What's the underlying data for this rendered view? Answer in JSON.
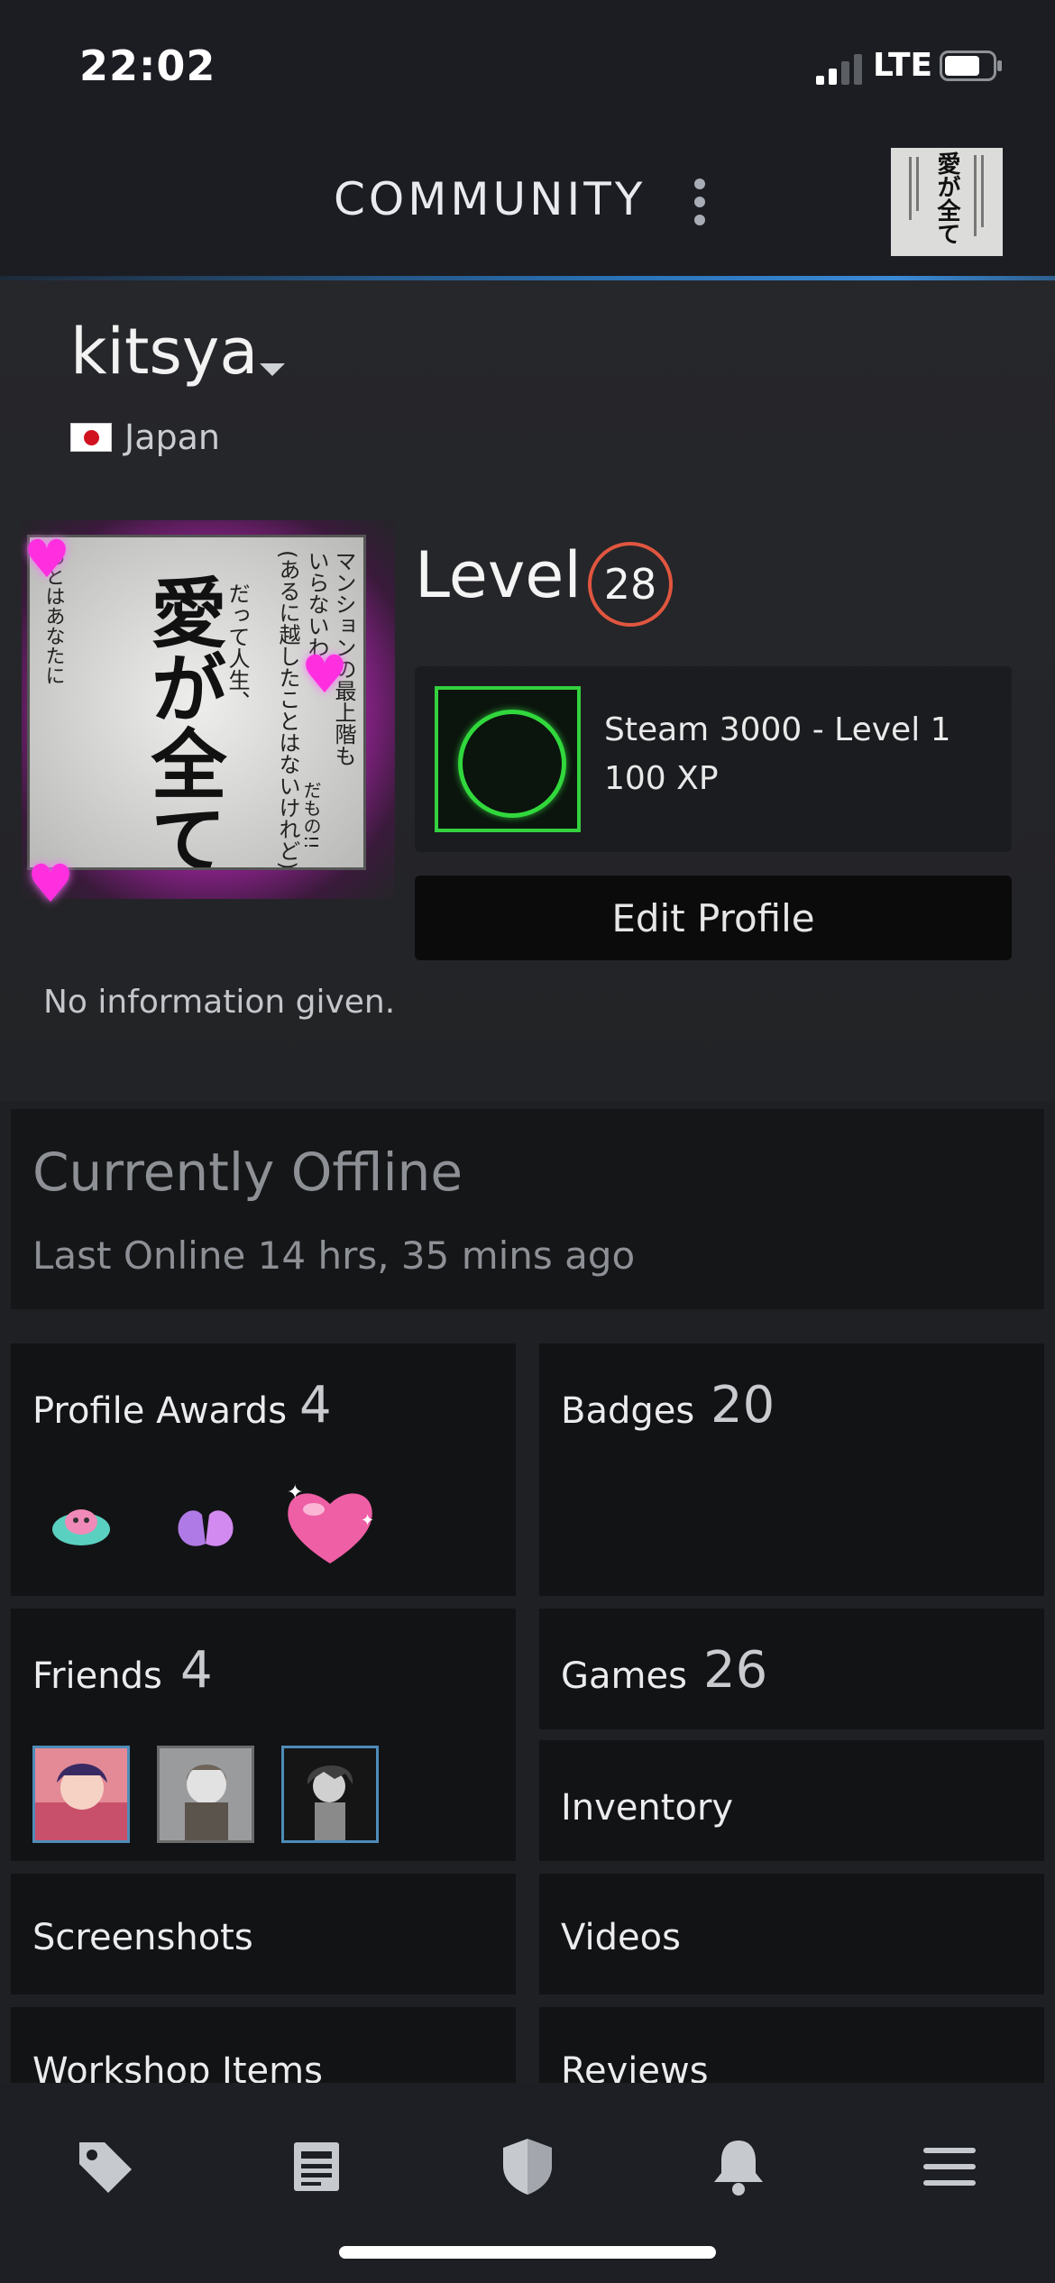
{
  "status_bar": {
    "time": "22:02",
    "network": "LTE"
  },
  "header": {
    "title": "COMMUNITY",
    "menu_icon": "kebab-menu-icon",
    "avatar_text": "愛が全て"
  },
  "profile": {
    "username": "kitsya",
    "country": "Japan",
    "avatar": {
      "headline": "愛が全て",
      "line1": "マンションの最上階も",
      "line2": "いらないわ!!",
      "line3": "(あるに越したことはないけれど)",
      "line4": "だって人生、",
      "line5": "あとはあなたに",
      "line6": "だもの!!"
    },
    "level_label": "Level",
    "level": "28",
    "xp_card": {
      "title": "Steam 3000 - Level 1",
      "points": "100 XP"
    },
    "edit_button": "Edit Profile",
    "summary": "No information given."
  },
  "status": {
    "title": "Currently Offline",
    "last_online": "Last Online 14 hrs, 35 mins ago"
  },
  "sections": {
    "profile_awards": {
      "label": "Profile Awards",
      "count": "4"
    },
    "badges": {
      "label": "Badges",
      "count": "20"
    },
    "friends": {
      "label": "Friends",
      "count": "4"
    },
    "games": {
      "label": "Games",
      "count": "26"
    },
    "inventory": {
      "label": "Inventory"
    },
    "screenshots": {
      "label": "Screenshots"
    },
    "videos": {
      "label": "Videos"
    },
    "workshop": {
      "label": "Workshop Items"
    },
    "reviews": {
      "label": "Reviews"
    }
  },
  "bottom_nav": [
    "tag-icon",
    "news-icon",
    "shield-icon",
    "bell-icon",
    "menu-icon"
  ],
  "colors": {
    "level_ring": "#e0563f",
    "badge_green": "#33d13f",
    "accent_blue": "#2a73b8"
  }
}
